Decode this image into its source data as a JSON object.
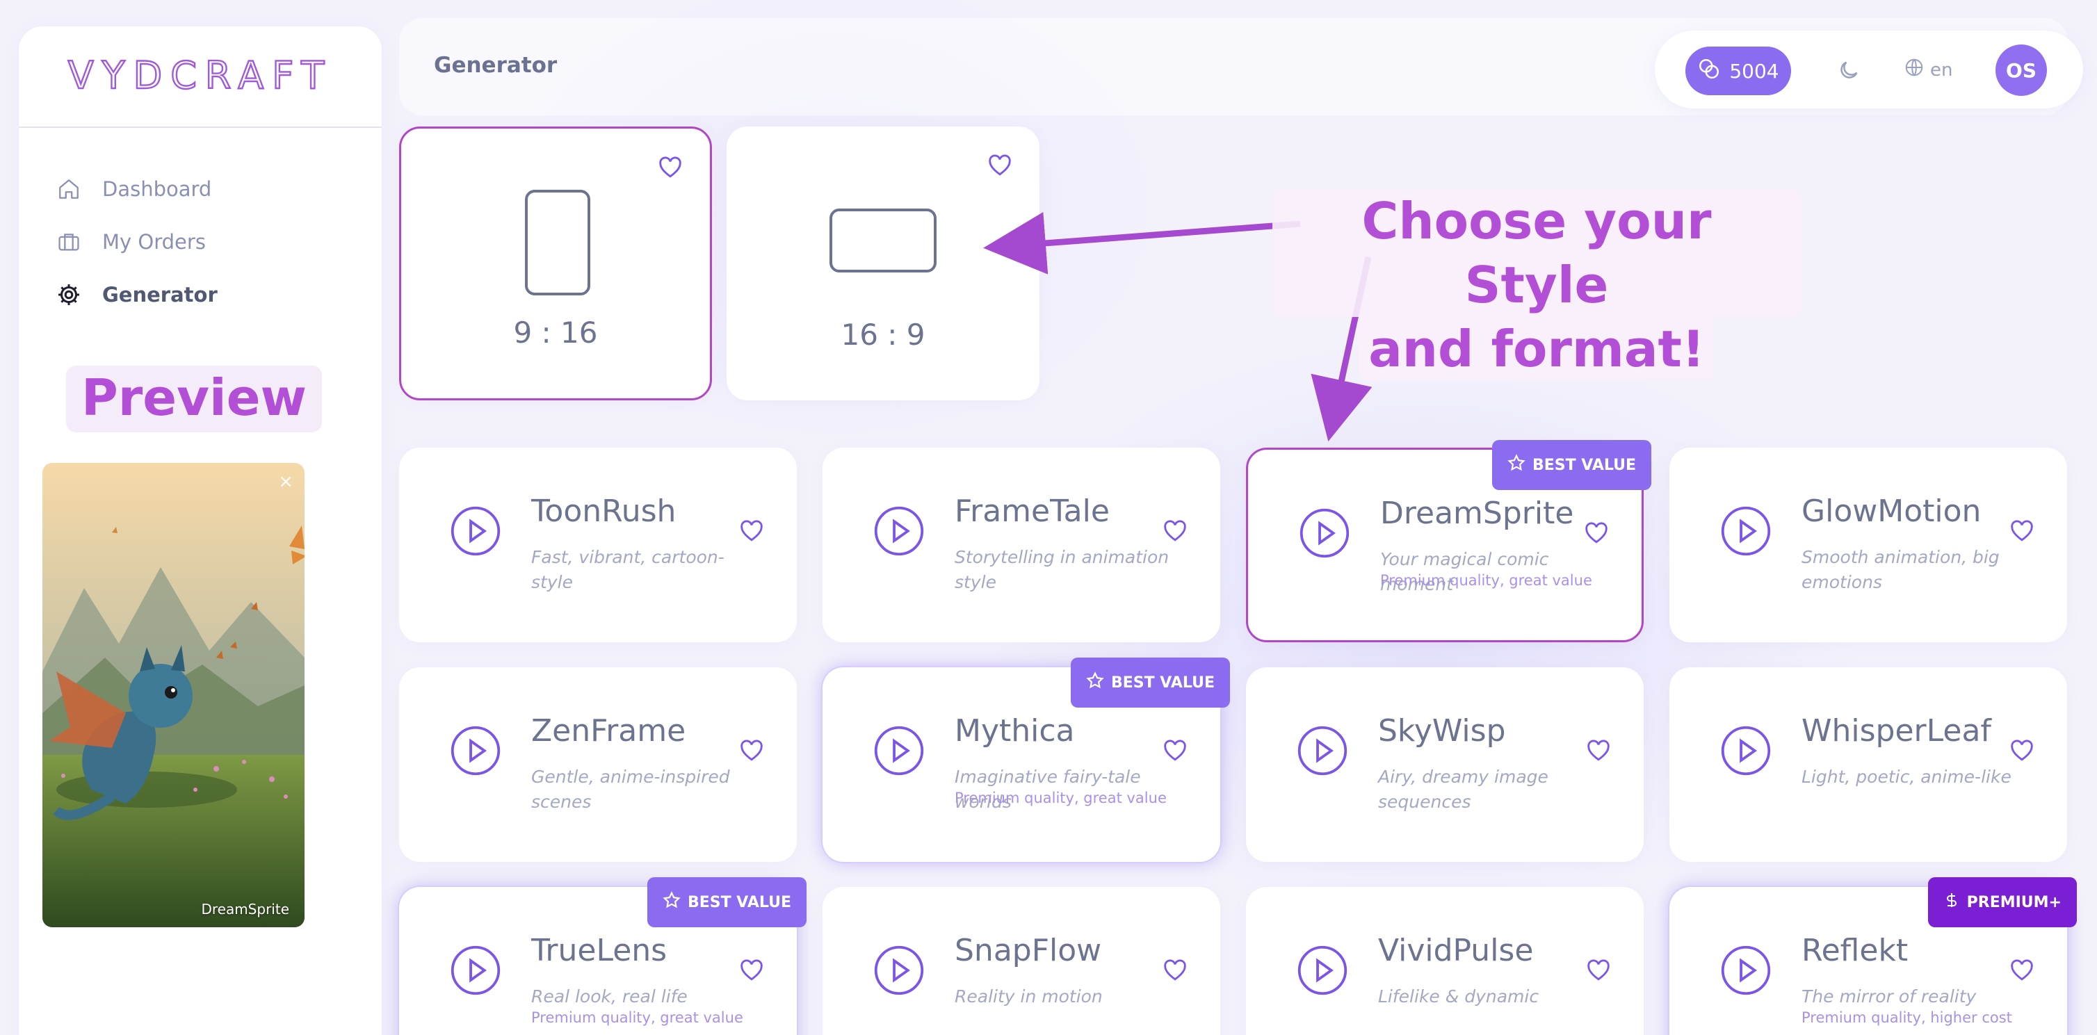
{
  "app": {
    "logo_text": "VYDCRAFT"
  },
  "sidebar": {
    "items": [
      {
        "label": "Dashboard",
        "icon": "home-icon"
      },
      {
        "label": "My Orders",
        "icon": "briefcase-icon"
      },
      {
        "label": "Generator",
        "icon": "gear-icon",
        "active": true
      }
    ],
    "preview_label": "Preview",
    "preview_caption": "DreamSprite",
    "preview_close": "×"
  },
  "header": {
    "title": "Generator",
    "credits": "5004",
    "language": "en",
    "avatar_initials": "OS"
  },
  "formats": [
    {
      "label": "9 : 16",
      "selected": true
    },
    {
      "label": "16 : 9",
      "selected": false
    }
  ],
  "annotation": {
    "line1": "Choose your Style",
    "line2": "and format!"
  },
  "styles": [
    {
      "name": "ToonRush",
      "desc": "Fast, vibrant, cartoon-style",
      "sub": "",
      "badge": ""
    },
    {
      "name": "FrameTale",
      "desc": "Storytelling in animation style",
      "sub": "",
      "badge": ""
    },
    {
      "name": "DreamSprite",
      "desc": "Your magical comic moment",
      "sub": "Premium quality, great value",
      "badge": "BEST VALUE"
    },
    {
      "name": "GlowMotion",
      "desc": "Smooth animation, big emotions",
      "sub": "",
      "badge": ""
    },
    {
      "name": "ZenFrame",
      "desc": "Gentle, anime-inspired scenes",
      "sub": "",
      "badge": ""
    },
    {
      "name": "Mythica",
      "desc": "Imaginative fairy-tale worlds",
      "sub": "Premium quality, great value",
      "badge": "BEST VALUE"
    },
    {
      "name": "SkyWisp",
      "desc": "Airy, dreamy image sequences",
      "sub": "",
      "badge": ""
    },
    {
      "name": "WhisperLeaf",
      "desc": "Light, poetic, anime-like",
      "sub": "",
      "badge": ""
    },
    {
      "name": "TrueLens",
      "desc": "Real look, real life",
      "sub": "Premium quality, great value",
      "badge": "BEST VALUE"
    },
    {
      "name": "SnapFlow",
      "desc": "Reality in motion",
      "sub": "",
      "badge": ""
    },
    {
      "name": "VividPulse",
      "desc": "Lifelike & dynamic",
      "sub": "",
      "badge": ""
    },
    {
      "name": "Reflekt",
      "desc": "The mirror of reality",
      "sub": "Premium quality, higher cost",
      "badge": "PREMIUM+"
    }
  ],
  "colors": {
    "accent": "#8b6cf0",
    "highlight": "#b24fd6",
    "text_muted": "#6c7390"
  }
}
